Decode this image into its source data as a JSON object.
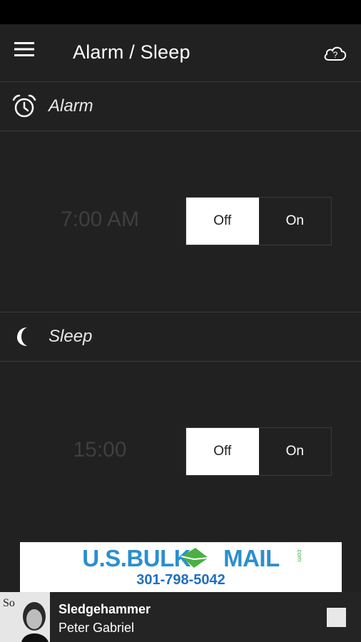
{
  "app": {
    "title": "Alarm / Sleep",
    "icons": {
      "menu": "hamburger-menu-icon",
      "help": "cloud-help-icon"
    }
  },
  "alarm": {
    "label": "Alarm",
    "icon": "alarm-clock-icon",
    "time": "7:00 AM",
    "toggle": {
      "off_label": "Off",
      "on_label": "On",
      "selected": "Off"
    }
  },
  "sleep": {
    "label": "Sleep",
    "icon": "crescent-moon-icon",
    "time": "15:00",
    "toggle": {
      "off_label": "Off",
      "on_label": "On",
      "selected": "Off"
    }
  },
  "ad": {
    "brand_prefix": "U.S.BULK",
    "brand_suffix": "MAIL",
    "brand_tld": ".com",
    "phone": "301-798-5042"
  },
  "player": {
    "track": "Sledgehammer",
    "artist": "Peter Gabriel",
    "album_art_text": "So"
  },
  "colors": {
    "background": "#212121",
    "divider": "#3a3a3a",
    "toggle_active": "#ffffff",
    "time_text": "#3f3f3f",
    "ad_blue": "#2a8fcf",
    "ad_green": "#4ab043"
  }
}
